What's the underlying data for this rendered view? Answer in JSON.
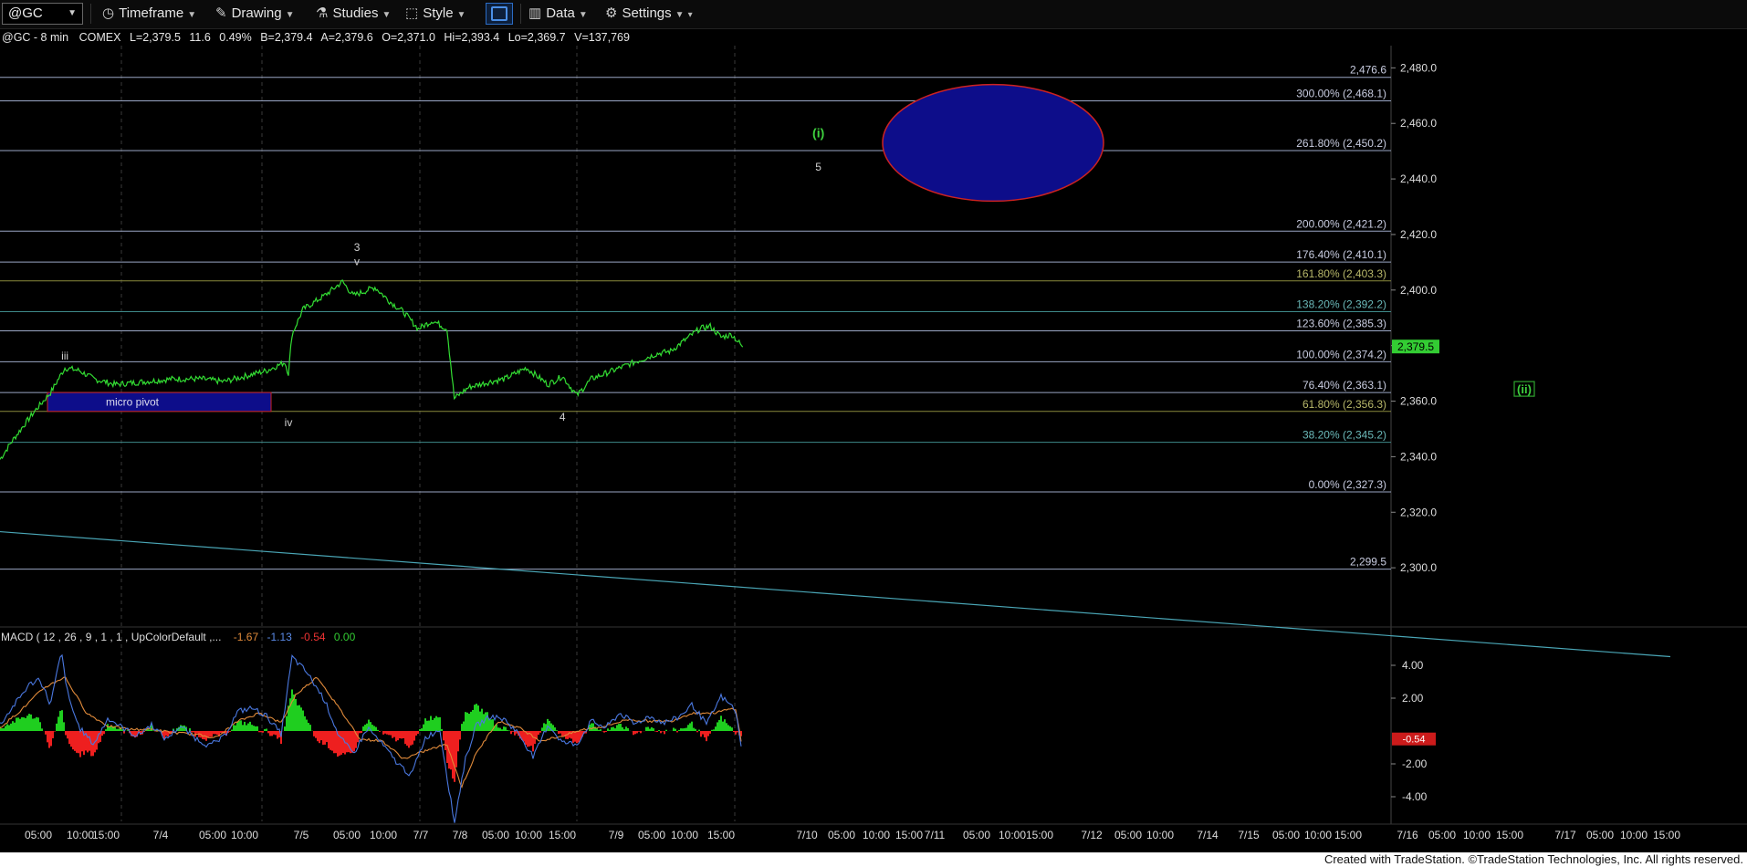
{
  "toolbar": {
    "symbol": "@GC",
    "timeframe": "Timeframe",
    "drawing": "Drawing",
    "studies": "Studies",
    "style": "Style",
    "data": "Data",
    "settings": "Settings"
  },
  "header": {
    "symbol": "@GC - 8 min",
    "exchange": "COMEX",
    "last": "L=2,379.5",
    "change": "11.6",
    "change_pct": "0.49%",
    "bid": "B=2,379.4",
    "ask": "A=2,379.6",
    "open": "O=2,371.0",
    "high": "Hi=2,393.4",
    "low": "Lo=2,369.7",
    "volume": "V=137,769"
  },
  "colors": {
    "price_line": "#33dd33",
    "fib_line": "#9aa6c4",
    "fib_olive": "#8a8a3c",
    "fib_teal": "#3e8a8a",
    "trendline": "#4aa6b6",
    "ellipse_fill": "#0d0d8a",
    "ellipse_stroke": "#cc2222",
    "macd_line": "#4a78e0",
    "signal_line": "#e08a3a",
    "hist_up": "#1fce1f",
    "hist_down": "#ee1f1f"
  },
  "chart_data": {
    "type": "line",
    "title": "@GC - 8 min",
    "ylim": [
      2280,
      2488
    ],
    "y_ticks": [
      "2,480.0",
      "2,460.0",
      "2,440.0",
      "2,420.0",
      "2,400.0",
      "2,380.0",
      "2,360.0",
      "2,340.0",
      "2,320.0",
      "2,300.0"
    ],
    "x_tick_labels": [
      "05:00",
      "10:00",
      "15:00",
      "7/4",
      "05:00",
      "10:00",
      "7/5",
      "05:00",
      "10:00",
      "7/7",
      "7/8",
      "05:00",
      "10:00",
      "15:00",
      "7/9",
      "05:00",
      "10:00",
      "15:00",
      "7/10",
      "05:00",
      "10:00",
      "15:00",
      "7/11",
      "05:00",
      "10:00",
      "15:00",
      "7/12",
      "05:00",
      "10:00",
      "7/14",
      "7/15",
      "05:00",
      "10:00",
      "15:00",
      "7/16",
      "05:00",
      "10:00",
      "15:00",
      "7/17",
      "05:00",
      "10:00",
      "15:00"
    ],
    "current_price": 2379.5,
    "current_price_label": "2,379.5",
    "price_series": [
      [
        0,
        2339
      ],
      [
        0.15,
        2345
      ],
      [
        0.35,
        2352
      ],
      [
        0.5,
        2357
      ],
      [
        0.7,
        2363
      ],
      [
        0.9,
        2372
      ],
      [
        1.1,
        2371
      ],
      [
        1.3,
        2368
      ],
      [
        1.6,
        2366
      ],
      [
        2.0,
        2367
      ],
      [
        2.4,
        2368
      ],
      [
        2.8,
        2368
      ],
      [
        3.1,
        2367
      ],
      [
        3.4,
        2369
      ],
      [
        3.7,
        2371
      ],
      [
        3.95,
        2374
      ],
      [
        4.0,
        2370
      ],
      [
        4.05,
        2384
      ],
      [
        4.2,
        2393
      ],
      [
        4.5,
        2398
      ],
      [
        4.75,
        2403
      ],
      [
        4.9,
        2398
      ],
      [
        5.2,
        2401
      ],
      [
        5.4,
        2396
      ],
      [
        5.6,
        2392
      ],
      [
        5.8,
        2386
      ],
      [
        6.0,
        2389
      ],
      [
        6.2,
        2386
      ],
      [
        6.3,
        2361
      ],
      [
        6.5,
        2365
      ],
      [
        6.8,
        2367
      ],
      [
        7.0,
        2368
      ],
      [
        7.3,
        2372
      ],
      [
        7.6,
        2366
      ],
      [
        7.8,
        2369
      ],
      [
        8.0,
        2362
      ],
      [
        8.2,
        2368
      ],
      [
        8.5,
        2371
      ],
      [
        8.8,
        2374
      ],
      [
        9.1,
        2377
      ],
      [
        9.3,
        2378
      ],
      [
        9.5,
        2382
      ],
      [
        9.7,
        2386
      ],
      [
        9.85,
        2387
      ],
      [
        10.0,
        2383
      ],
      [
        10.15,
        2384
      ],
      [
        10.3,
        2379.5
      ]
    ],
    "fib_levels": [
      {
        "pct": "",
        "price": 2476.6,
        "label": "2,476.6"
      },
      {
        "pct": "300.00%",
        "price": 2468.1,
        "label": "300.00% (2,468.1)"
      },
      {
        "pct": "261.80%",
        "price": 2450.2,
        "label": "261.80% (2,450.2)"
      },
      {
        "pct": "200.00%",
        "price": 2421.2,
        "label": "200.00% (2,421.2)"
      },
      {
        "pct": "176.40%",
        "price": 2410.1,
        "label": "176.40% (2,410.1)"
      },
      {
        "pct": "161.80%",
        "price": 2403.3,
        "label": "161.80% (2,403.3)"
      },
      {
        "pct": "138.20%",
        "price": 2392.2,
        "label": "138.20% (2,392.2)"
      },
      {
        "pct": "123.60%",
        "price": 2385.3,
        "label": "123.60% (2,385.3)"
      },
      {
        "pct": "100.00%",
        "price": 2374.2,
        "label": "100.00% (2,374.2)"
      },
      {
        "pct": "76.40%",
        "price": 2363.1,
        "label": "76.40% (2,363.1)"
      },
      {
        "pct": "61.80%",
        "price": 2356.3,
        "label": "61.80% (2,356.3)"
      },
      {
        "pct": "38.20%",
        "price": 2345.2,
        "label": "38.20% (2,345.2)"
      },
      {
        "pct": "0.00%",
        "price": 2327.3,
        "label": "0.00% (2,327.3)"
      },
      {
        "pct": "",
        "price": 2299.5,
        "label": "2,299.5"
      }
    ],
    "wave_labels": [
      {
        "text": "iii",
        "x": 0.9,
        "price": 2375
      },
      {
        "text": "iv",
        "x": 4.0,
        "price": 2351
      },
      {
        "text": "3",
        "x": 4.95,
        "price": 2414
      },
      {
        "text": "v",
        "x": 4.95,
        "price": 2409
      },
      {
        "text": "4",
        "x": 7.8,
        "price": 2353
      },
      {
        "text": "(i)",
        "x": 11.35,
        "price": 2455
      },
      {
        "text": "5",
        "x": 11.35,
        "price": 2443
      }
    ],
    "ii_label": "(ii)",
    "ii_price": 2363.1,
    "micro_pivot_label": "micro pivot",
    "micro_pivot_range": [
      2356.3,
      2363.1
    ],
    "target_zone": {
      "center_price": 2453,
      "half_height": 21
    },
    "trendline": {
      "start_price": 2313,
      "end_price": 2268
    },
    "macd": {
      "title": "MACD ( 12 , 26 , 9 , 1 , 1 , UpColorDefault ,...",
      "macd_value": "-1.67",
      "signal_value": "-1.13",
      "diff_value": "-0.54",
      "zero_value": "0.00",
      "current_label": "-0.54",
      "ylim": [
        -5.5,
        5.5
      ],
      "y_ticks": [
        "4.00",
        "2.00",
        "-2.00",
        "-4.00"
      ],
      "macd_series": [
        [
          0,
          0.4
        ],
        [
          0.2,
          1.6
        ],
        [
          0.4,
          2.8
        ],
        [
          0.55,
          3.2
        ],
        [
          0.7,
          1.6
        ],
        [
          0.85,
          4.8
        ],
        [
          0.95,
          2.0
        ],
        [
          1.1,
          0.2
        ],
        [
          1.3,
          -0.8
        ],
        [
          1.5,
          0.8
        ],
        [
          1.7,
          0.2
        ],
        [
          1.9,
          -0.3
        ],
        [
          2.1,
          0.4
        ],
        [
          2.3,
          -0.5
        ],
        [
          2.5,
          0.3
        ],
        [
          2.7,
          -0.4
        ],
        [
          2.9,
          -0.9
        ],
        [
          3.1,
          -0.4
        ],
        [
          3.3,
          1.2
        ],
        [
          3.5,
          1.4
        ],
        [
          3.7,
          0.9
        ],
        [
          3.9,
          -0.2
        ],
        [
          4.05,
          4.5
        ],
        [
          4.25,
          3.6
        ],
        [
          4.5,
          1.9
        ],
        [
          4.7,
          -0.3
        ],
        [
          4.9,
          -1.4
        ],
        [
          5.1,
          0.2
        ],
        [
          5.3,
          -0.8
        ],
        [
          5.5,
          -1.9
        ],
        [
          5.7,
          -2.7
        ],
        [
          5.9,
          -0.4
        ],
        [
          6.1,
          0.1
        ],
        [
          6.3,
          -5.6
        ],
        [
          6.45,
          -1.8
        ],
        [
          6.6,
          0.3
        ],
        [
          6.8,
          0.9
        ],
        [
          7.0,
          0.7
        ],
        [
          7.2,
          -0.2
        ],
        [
          7.4,
          -1.6
        ],
        [
          7.6,
          0.4
        ],
        [
          7.8,
          -0.7
        ],
        [
          8.0,
          -0.8
        ],
        [
          8.2,
          0.6
        ],
        [
          8.4,
          0.2
        ],
        [
          8.6,
          1.1
        ],
        [
          8.8,
          0.4
        ],
        [
          9.0,
          0.9
        ],
        [
          9.2,
          0.5
        ],
        [
          9.4,
          0.8
        ],
        [
          9.6,
          1.6
        ],
        [
          9.8,
          0.4
        ],
        [
          10.0,
          2.1
        ],
        [
          10.2,
          1.3
        ],
        [
          10.3,
          -1.67
        ]
      ],
      "signal_series": [
        [
          0,
          0.2
        ],
        [
          0.3,
          1.3
        ],
        [
          0.6,
          2.6
        ],
        [
          0.9,
          3.3
        ],
        [
          1.2,
          1.1
        ],
        [
          1.5,
          0.3
        ],
        [
          1.8,
          0.1
        ],
        [
          2.1,
          0.1
        ],
        [
          2.4,
          -0.1
        ],
        [
          2.7,
          -0.2
        ],
        [
          3.0,
          -0.4
        ],
        [
          3.3,
          0.6
        ],
        [
          3.6,
          1.1
        ],
        [
          3.9,
          0.5
        ],
        [
          4.1,
          2.2
        ],
        [
          4.4,
          3.3
        ],
        [
          4.7,
          1.4
        ],
        [
          5.0,
          -0.5
        ],
        [
          5.3,
          -0.6
        ],
        [
          5.6,
          -1.7
        ],
        [
          5.9,
          -1.2
        ],
        [
          6.2,
          -0.8
        ],
        [
          6.4,
          -3.4
        ],
        [
          6.6,
          -1.4
        ],
        [
          6.9,
          0.6
        ],
        [
          7.2,
          0.2
        ],
        [
          7.5,
          -0.6
        ],
        [
          7.8,
          -0.3
        ],
        [
          8.1,
          0.1
        ],
        [
          8.4,
          0.3
        ],
        [
          8.7,
          0.7
        ],
        [
          9.0,
          0.6
        ],
        [
          9.3,
          0.6
        ],
        [
          9.6,
          1.1
        ],
        [
          9.9,
          1.1
        ],
        [
          10.2,
          1.4
        ],
        [
          10.3,
          -1.13
        ]
      ]
    }
  },
  "footer": "Created with TradeStation. ©TradeStation Technologies, Inc. All rights reserved."
}
